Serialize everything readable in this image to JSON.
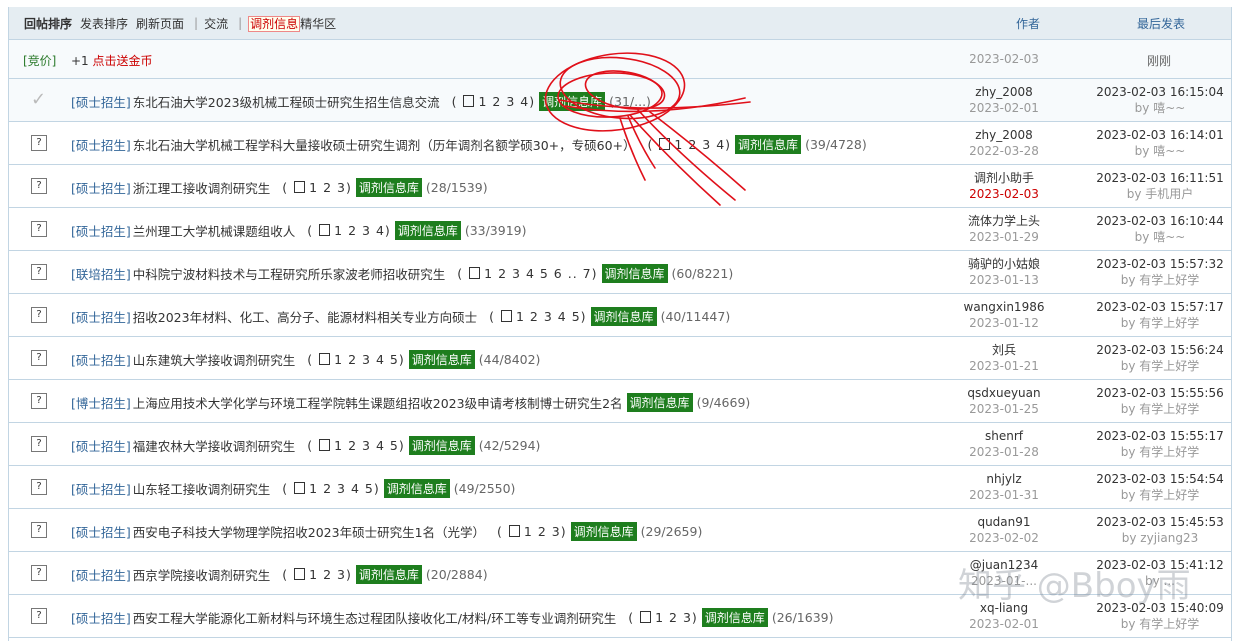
{
  "header": {
    "tabs": [
      {
        "label": "回帖排序",
        "active": true
      },
      {
        "label": "发表排序"
      },
      {
        "label": "刷新页面"
      },
      {
        "label": "交流"
      },
      {
        "label": "调剂信息",
        "red": true
      },
      {
        "label": "精华区"
      }
    ],
    "author_col": "作者",
    "last_col": "最后发表"
  },
  "bid_row": {
    "bid_label": "[竞价]",
    "gold_text": "+1",
    "gold_link": "点击送金币",
    "date": "2023-02-03",
    "last": "刚刚"
  },
  "threads": [
    {
      "icon": "check",
      "cat": "[硕士招生]",
      "subj": "东北石油大学2023级机械工程硕士研究生招生信息交流",
      "pages": "1 2 3 4",
      "tag": "调剂信息库",
      "stat": "(31/...)",
      "author": "zhy_2008",
      "adate": "2023-02-01",
      "last": "2023-02-03 16:15:04",
      "by": "by 嘻~~"
    },
    {
      "icon": "q",
      "cat": "[硕士招生]",
      "subj": "东北石油大学机械工程学科大量接收硕士研究生调剂（历年调剂名额学硕30+，专硕60+）",
      "pages": "1 2 3 4",
      "tag": "调剂信息库",
      "stat": "(39/4728)",
      "author": "zhy_2008",
      "adate": "2022-03-28",
      "last": "2023-02-03 16:14:01",
      "by": "by 嘻~~"
    },
    {
      "icon": "q",
      "cat": "[硕士招生]",
      "subj": "浙江理工接收调剂研究生",
      "pages": "1 2 3",
      "tag": "调剂信息库",
      "stat": "(28/1539)",
      "author": "调剂小助手",
      "adate": "2023-02-03",
      "adate_red": true,
      "last": "2023-02-03 16:11:51",
      "by": "by 手机用户"
    },
    {
      "icon": "q",
      "cat": "[硕士招生]",
      "subj": "兰州理工大学机械课题组收人",
      "pages": "1 2 3 4",
      "tag": "调剂信息库",
      "stat": "(33/3919)",
      "author": "流体力学上头",
      "adate": "2023-01-29",
      "last": "2023-02-03 16:10:44",
      "by": "by 嘻~~"
    },
    {
      "icon": "q",
      "cat": "[联培招生]",
      "subj": "中科院宁波材料技术与工程研究所乐家波老师招收研究生",
      "pages": "1 2 3 4 5 6 .. 7",
      "tag": "调剂信息库",
      "stat": "(60/8221)",
      "author": "骑驴的小姑娘",
      "adate": "2023-01-13",
      "last": "2023-02-03 15:57:32",
      "by": "by 有学上好学"
    },
    {
      "icon": "q",
      "cat": "[硕士招生]",
      "subj": "招收2023年材料、化工、高分子、能源材料相关专业方向硕士",
      "pages": "1 2 3 4 5",
      "tag": "调剂信息库",
      "stat": "(40/11447)",
      "author": "wangxin1986",
      "adate": "2023-01-12",
      "last": "2023-02-03 15:57:17",
      "by": "by 有学上好学"
    },
    {
      "icon": "q",
      "cat": "[硕士招生]",
      "subj": "山东建筑大学接收调剂研究生",
      "pages": "1 2 3 4 5",
      "tag": "调剂信息库",
      "stat": "(44/8402)",
      "author": "刘兵",
      "adate": "2023-01-21",
      "last": "2023-02-03 15:56:24",
      "by": "by 有学上好学"
    },
    {
      "icon": "q",
      "cat": "[博士招生]",
      "subj": "上海应用技术大学化学与环境工程学院韩生课题组招收2023级申请考核制博士研究生2名",
      "pages": "",
      "tag": "调剂信息库",
      "stat": "(9/4669)",
      "author": "qsdxueyuan",
      "adate": "2023-01-25",
      "last": "2023-02-03 15:55:56",
      "by": "by 有学上好学"
    },
    {
      "icon": "q",
      "cat": "[硕士招生]",
      "subj": "福建农林大学接收调剂研究生",
      "pages": "1 2 3 4 5",
      "tag": "调剂信息库",
      "stat": "(42/5294)",
      "author": "shenrf",
      "adate": "2023-01-28",
      "last": "2023-02-03 15:55:17",
      "by": "by 有学上好学"
    },
    {
      "icon": "q",
      "cat": "[硕士招生]",
      "subj": "山东轻工接收调剂研究生",
      "pages": "1 2 3 4 5",
      "tag": "调剂信息库",
      "stat": "(49/2550)",
      "author": "nhjylz",
      "adate": "2023-01-31",
      "last": "2023-02-03 15:54:54",
      "by": "by 有学上好学"
    },
    {
      "icon": "q",
      "cat": "[硕士招生]",
      "subj": "西安电子科技大学物理学院招收2023年硕士研究生1名（光学）",
      "pages": "1 2 3",
      "tag": "调剂信息库",
      "stat": "(29/2659)",
      "author": "qudan91",
      "adate": "2023-02-02",
      "last": "2023-02-03 15:45:53",
      "by": "by zyjiang23"
    },
    {
      "icon": "q",
      "cat": "[硕士招生]",
      "subj": "西京学院接收调剂研究生",
      "pages": "1 2 3",
      "tag": "调剂信息库",
      "stat": "(20/2884)",
      "author": "@juan1234",
      "adate": "2023-01-...",
      "last": "2023-02-03 15:41:12",
      "by": "by ..."
    },
    {
      "icon": "q",
      "cat": "[硕士招生]",
      "subj": "西安工程大学能源化工新材料与环境生态过程团队接收化工/材料/环工等专业调剂研究生",
      "pages": "1 2 3",
      "tag": "调剂信息库",
      "stat": "(26/1639)",
      "author": "xq-liang",
      "adate": "2023-02-01",
      "last": "2023-02-03 15:40:09",
      "by": "by 有学上好学"
    }
  ],
  "watermark": "知乎 @Bboy雨",
  "icons": {
    "check": "check-icon",
    "question": "question-icon",
    "pages": "pages-icon"
  }
}
